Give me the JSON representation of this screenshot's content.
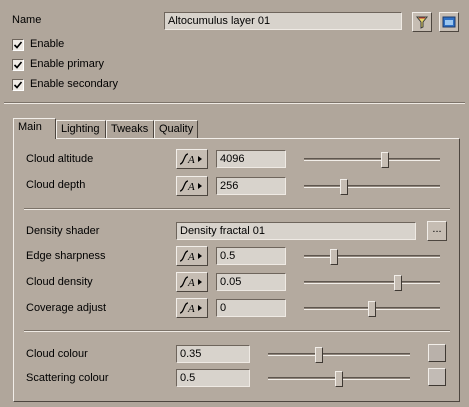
{
  "name_row": {
    "label": "Name",
    "value": "Altocumulus layer 01"
  },
  "checkboxes": [
    {
      "label": "Enable",
      "checked": true
    },
    {
      "label": "Enable primary",
      "checked": true
    },
    {
      "label": "Enable secondary",
      "checked": true
    }
  ],
  "tabs": [
    {
      "label": "Main",
      "active": true
    },
    {
      "label": "Lighting",
      "active": false
    },
    {
      "label": "Tweaks",
      "active": false
    },
    {
      "label": "Quality",
      "active": false
    }
  ],
  "main": {
    "cloud_altitude": {
      "label": "Cloud altitude",
      "value": "4096",
      "slider": 0.6
    },
    "cloud_depth": {
      "label": "Cloud depth",
      "value": "256",
      "slider": 0.28
    },
    "density_shader": {
      "label": "Density shader",
      "value": "Density fractal 01",
      "browse": "..."
    },
    "edge_sharpness": {
      "label": "Edge sharpness",
      "value": "0.5",
      "slider": 0.2
    },
    "cloud_density": {
      "label": "Cloud density",
      "value": "0.05",
      "slider": 0.7
    },
    "coverage_adjust": {
      "label": "Coverage adjust",
      "value": "0",
      "slider": 0.5
    },
    "cloud_colour": {
      "label": "Cloud colour",
      "value": "0.35",
      "slider": 0.35,
      "swatch": "#b9b1aa"
    },
    "scattering_colour": {
      "label": "Scattering colour",
      "value": "0.5",
      "slider": 0.5,
      "swatch": "#c2bbb5"
    }
  },
  "colors": {
    "background": "#b0a69b",
    "field": "#d8d3cc"
  }
}
